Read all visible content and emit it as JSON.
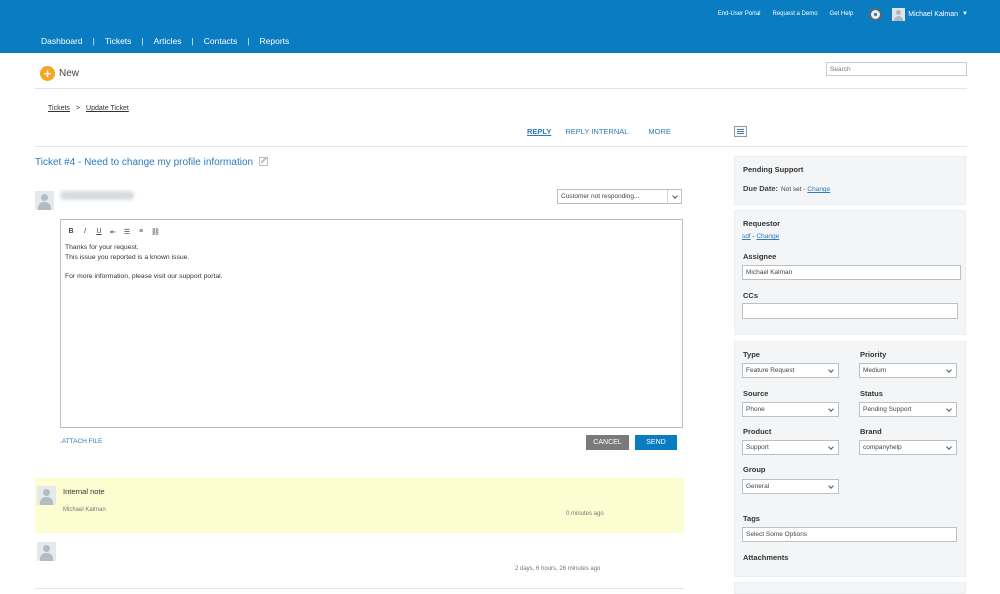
{
  "topbar": {
    "links": [
      "End-User Portal",
      "Request a Demo",
      "Get Help"
    ],
    "help_icon": "lifebuoy-icon",
    "user_name": "Michael Kalman",
    "user_caret": "▼"
  },
  "nav": {
    "items": [
      "Dashboard",
      "Tickets",
      "Articles",
      "Contacts",
      "Reports"
    ],
    "separator": "|"
  },
  "new_button": {
    "label": "New",
    "icon": "plus-circle-icon"
  },
  "search": {
    "placeholder": "Search"
  },
  "breadcrumb": {
    "items": [
      "Tickets",
      "Update Ticket"
    ],
    "separator": ">"
  },
  "tabs": [
    "REPLY",
    "REPLY INTERNAL",
    "MORE"
  ],
  "ticket": {
    "title": "Ticket #4 - Need to change my profile information"
  },
  "reply": {
    "status_select": "Customer not responding...",
    "toolbar": [
      "B",
      "I",
      "U",
      "⇤",
      "☰",
      "≡",
      "⛓"
    ],
    "body_lines": [
      "Thanks for your request.",
      "This issue you reported is a known issue.",
      "",
      "For more information, please visit our support portal."
    ],
    "attach_label": ".ATTACH FILE",
    "cancel_label": "CANCEL",
    "send_label": "SEND"
  },
  "notes": [
    {
      "title": "Internal note",
      "author": "Michael Kalman",
      "time": "0 minutes ago"
    },
    {
      "title": "",
      "author": "",
      "time": "2 days, 6 hours, 26 minutes ago"
    }
  ],
  "sidebar": {
    "status": "Pending Support",
    "due_date_label": "Due Date:",
    "due_date_value": "Not set",
    "due_date_sep": " - ",
    "change_label": "Change",
    "requestor_label": "Requestor",
    "requestor_value": "sdf",
    "requestor_sep": " - ",
    "assignee_label": "Assignee",
    "assignee_value": "Michael Kalman",
    "ccs_label": "CCs",
    "type_label": "Type",
    "type_value": "Feature Request",
    "priority_label": "Priority",
    "priority_value": "Medium",
    "source_label": "Source",
    "source_value": "Phone",
    "status_label": "Status",
    "status_value": "Pending Support",
    "product_label": "Product",
    "product_value": "Support",
    "brand_label": "Brand",
    "brand_value": "companyhelp",
    "group_label": "Group",
    "group_value": "General",
    "tags_label": "Tags",
    "tags_placeholder": "Select Some Options",
    "attachments_label": "Attachments"
  }
}
